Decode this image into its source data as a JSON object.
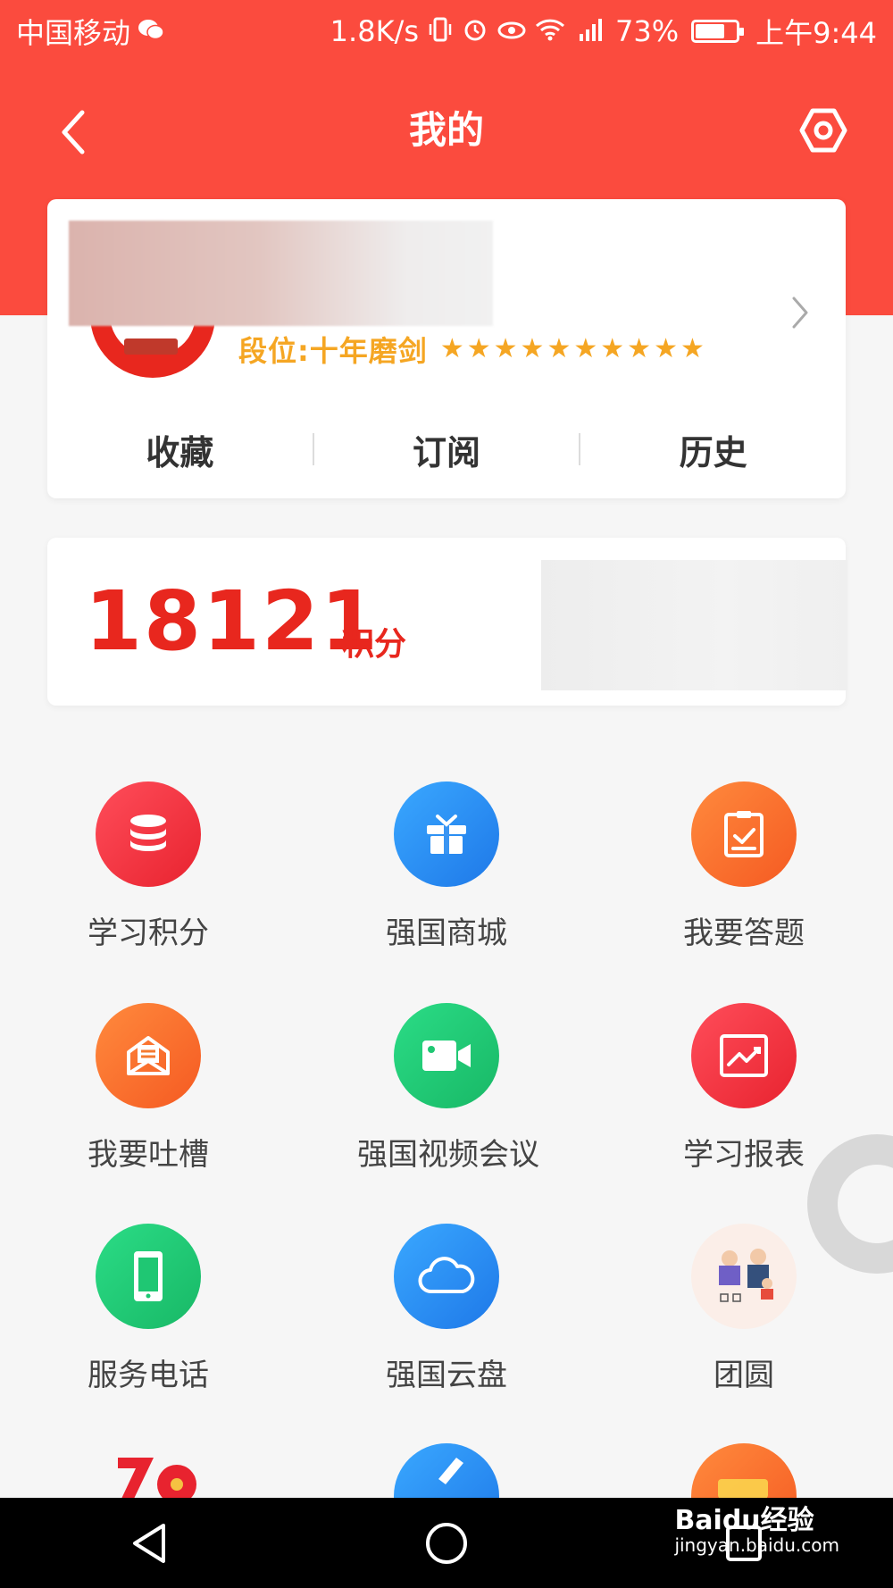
{
  "statusbar": {
    "carrier": "中国移动",
    "speed": "1.8K/s",
    "battery": "73%",
    "battery_level": 0.73,
    "time": "上午9:44"
  },
  "header": {
    "title": "我的"
  },
  "profile": {
    "rank": "段位:十年磨剑",
    "stars": 10,
    "links": [
      "收藏",
      "订阅",
      "历史"
    ]
  },
  "points": {
    "value": "18121",
    "unit": "积分"
  },
  "grid": [
    {
      "label": "学习积分",
      "color": "red",
      "icon": "database-icon"
    },
    {
      "label": "强国商城",
      "color": "blue",
      "icon": "gift-icon"
    },
    {
      "label": "我要答题",
      "color": "orange",
      "icon": "clipboard-check-icon"
    },
    {
      "label": "我要吐槽",
      "color": "orange",
      "icon": "mail-open-icon"
    },
    {
      "label": "强国视频会议",
      "color": "green",
      "icon": "video-camera-icon"
    },
    {
      "label": "学习报表",
      "color": "red",
      "icon": "chart-report-icon"
    },
    {
      "label": "服务电话",
      "color": "green",
      "icon": "phone-icon"
    },
    {
      "label": "强国云盘",
      "color": "blue",
      "icon": "cloud-icon"
    },
    {
      "label": "团圆",
      "color": "peach",
      "icon": "family-illustration-icon"
    }
  ],
  "watermark": {
    "brand": "Baidu经验",
    "url": "jingyan.baidu.com"
  }
}
